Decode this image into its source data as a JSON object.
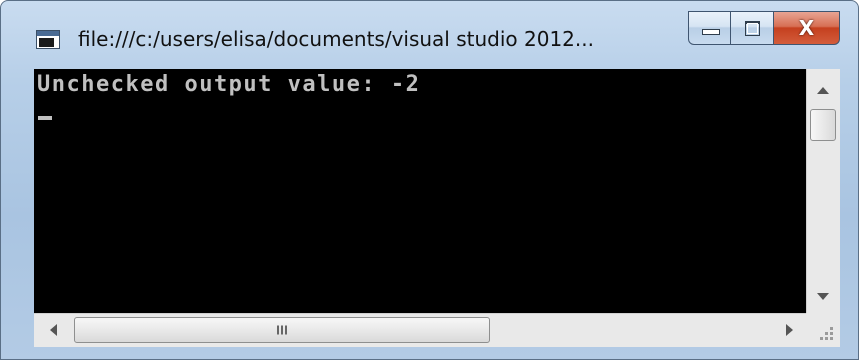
{
  "window": {
    "title": "file:///c:/users/elisa/documents/visual studio 2012...",
    "icon": "console-app-icon"
  },
  "caption_buttons": {
    "minimize_icon": "minimize-icon",
    "maximize_icon": "maximize-icon",
    "close_glyph": "X"
  },
  "console": {
    "output_line": "Unchecked output value: -2",
    "background": "#000000",
    "text_color": "#c0c0c0"
  },
  "scrollbars": {
    "vertical_thumb_glyph": "",
    "horizontal_thumb_glyph": "III"
  }
}
